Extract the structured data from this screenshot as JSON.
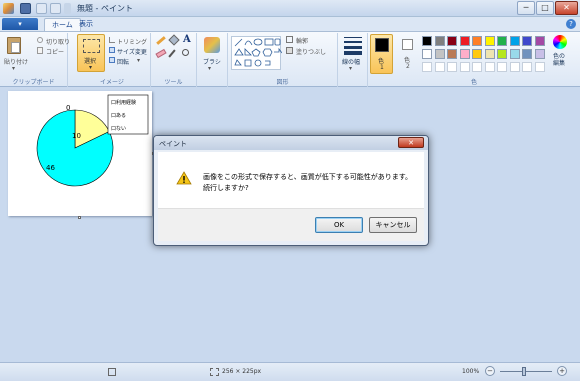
{
  "window": {
    "title": "無題 - ペイント",
    "minimize": "─",
    "maximize": "□",
    "close": "✕"
  },
  "tabs": {
    "file_menu": "▾",
    "home": "ホーム",
    "view": "表示",
    "help": "?"
  },
  "ribbon": {
    "clipboard": {
      "label": "クリップボード",
      "paste": "貼り付け",
      "cut": "切り取り",
      "copy": "コピー"
    },
    "image": {
      "label": "イメージ",
      "select": "選択",
      "crop": "トリミング",
      "resize": "サイズ変更",
      "rotate": "回転"
    },
    "tools": {
      "label": "ツール",
      "text_tool": "A"
    },
    "brushes": {
      "label": "ブラシ"
    },
    "shapes": {
      "label": "図形",
      "outline": "輪郭",
      "fill": "塗りつぶし"
    },
    "size": {
      "label": "線の幅"
    },
    "colors": {
      "label": "色",
      "color1_label": "色",
      "color1_num": "1",
      "color2_label": "色",
      "color2_num": "2",
      "edit_colors": "色の編集",
      "color1": "#000000",
      "color2": "#ffffff",
      "palette_row1": [
        "#000000",
        "#7f7f7f",
        "#880015",
        "#ed1c24",
        "#ff7f27",
        "#fff200",
        "#22b14c",
        "#00a2e8",
        "#3f48cc",
        "#a349a4"
      ],
      "palette_row2": [
        "#ffffff",
        "#c3c3c3",
        "#b97a57",
        "#ffaec9",
        "#ffc90e",
        "#efe4b0",
        "#b5e61d",
        "#99d9ea",
        "#7092be",
        "#c8bfe7"
      ]
    }
  },
  "canvas_chart": {
    "label_zero": "0",
    "label_ten": "10",
    "label_fortysix": "46",
    "legend": [
      "口利用経験",
      "口ある",
      "口ない"
    ]
  },
  "chart_data": {
    "type": "pie",
    "categories": [
      "利用経験",
      "ある",
      "ない"
    ],
    "values": [
      0,
      10,
      46
    ],
    "colors": [
      "#0000ff",
      "#ffff99",
      "#00ffff"
    ]
  },
  "dialog": {
    "title": "ペイント",
    "close": "✕",
    "message_line1": "画像をこの形式で保存すると、画質が低下する可能性があります。",
    "message_line2": "続行しますか?",
    "ok": "OK",
    "cancel": "キャンセル"
  },
  "status": {
    "size": "256 × 225px",
    "zoom": "100%",
    "zoom_out": "−",
    "zoom_in": "+"
  }
}
